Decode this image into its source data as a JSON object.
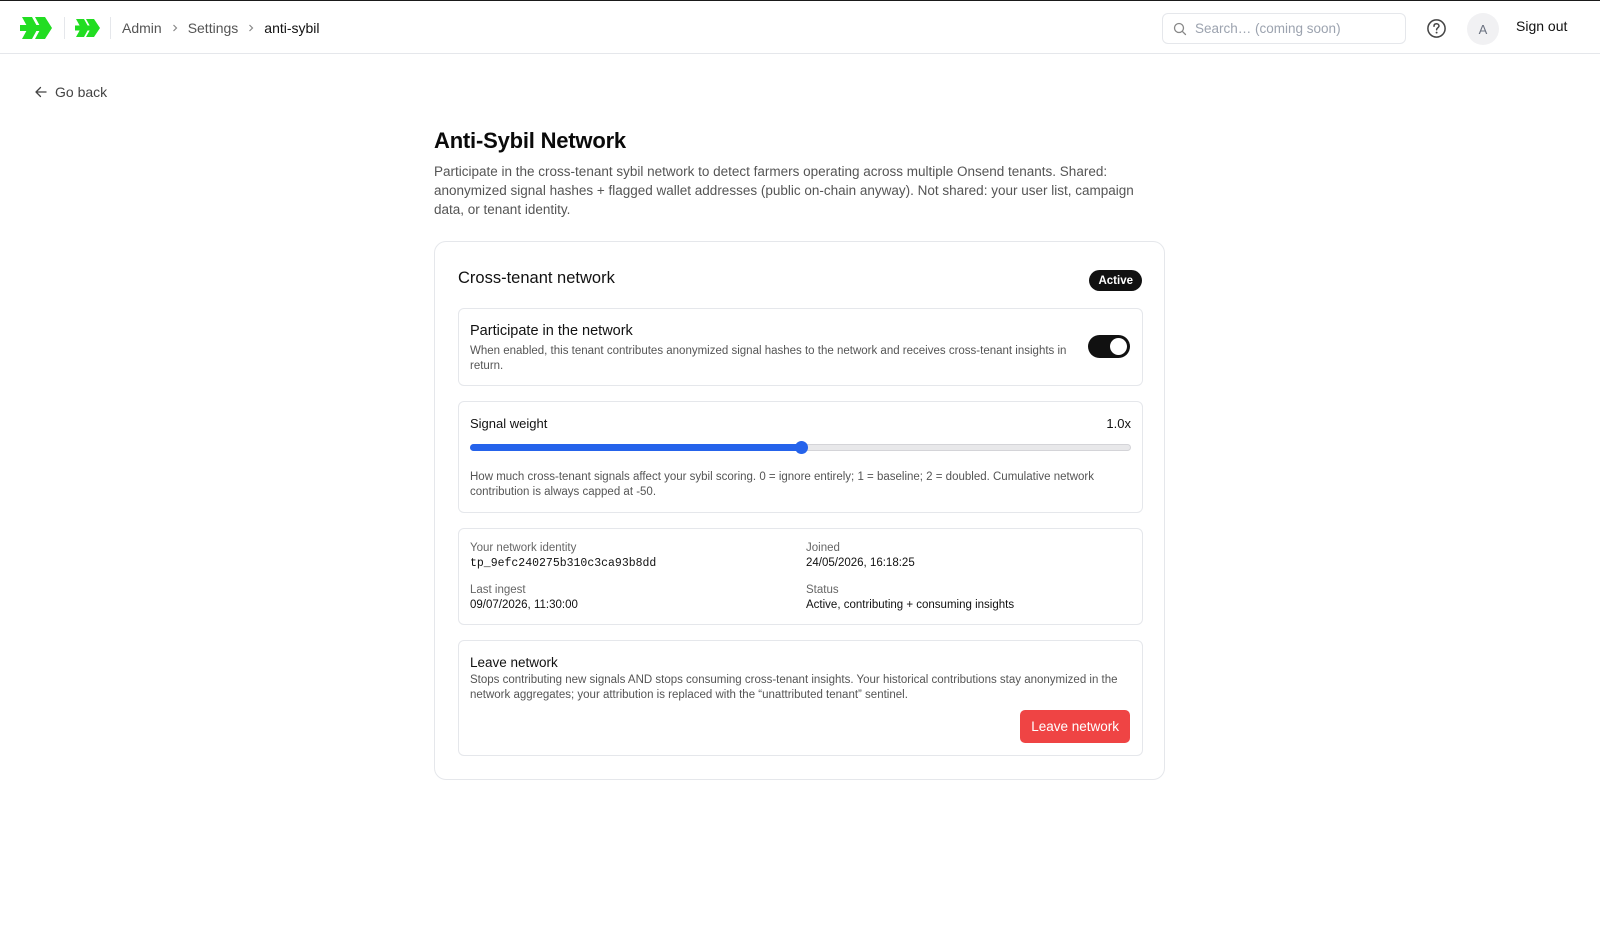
{
  "header": {
    "breadcrumbs": [
      "Admin",
      "Settings",
      "anti-sybil"
    ],
    "search": {
      "placeholder": "Search… (coming soon)",
      "value": ""
    },
    "avatar_initial": "A",
    "sign_out": "Sign out",
    "logo_color": "#22dd22"
  },
  "nav": {
    "go_back": "Go back"
  },
  "page": {
    "title": "Anti-Sybil Network",
    "description": "Participate in the cross-tenant sybil network to detect farmers operating across multiple Onsend tenants. Shared: anonymized signal hashes + flagged wallet addresses (public on-chain anyway). Not shared: your user list, campaign data, or tenant identity."
  },
  "card": {
    "title": "Cross-tenant network",
    "badge": "Active",
    "participate": {
      "title": "Participate in the network",
      "description": "When enabled, this tenant contributes anonymized signal hashes to the network and receives cross-tenant insights in return.",
      "enabled": true
    },
    "signal_weight": {
      "label": "Signal weight",
      "value_label": "1.0x",
      "value": 1.0,
      "min": 0,
      "max": 2,
      "help": "How much cross-tenant signals affect your sybil scoring. 0 = ignore entirely; 1 = baseline; 2 = doubled. Cumulative network contribution is always capped at -50."
    },
    "details": {
      "identity_label": "Your network identity",
      "identity_value": "tp_9efc240275b310c3ca93b8dd",
      "joined_label": "Joined",
      "joined_value": "24/05/2026, 16:18:25",
      "last_ingest_label": "Last ingest",
      "last_ingest_value": "09/07/2026, 11:30:00",
      "status_label": "Status",
      "status_value": "Active, contributing + consuming insights"
    },
    "leave": {
      "title": "Leave network",
      "description": "Stops contributing new signals AND stops consuming cross-tenant insights. Your historical contributions stay anonymized in the network aggregates; your attribution is replaced with the “unattributed tenant” sentinel.",
      "button": "Leave network"
    }
  },
  "colors": {
    "accent": "#2563eb",
    "danger": "#ef4444",
    "badge_bg": "#111111"
  }
}
